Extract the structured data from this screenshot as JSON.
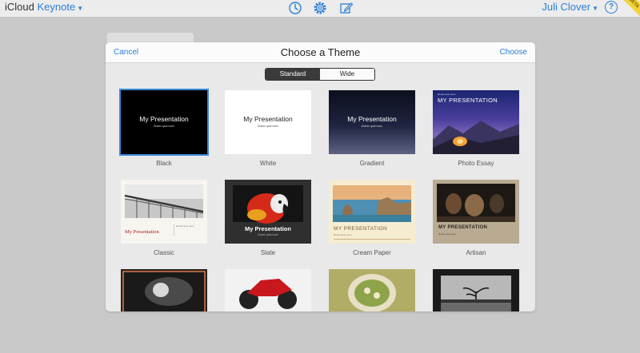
{
  "app": {
    "brand": "iCloud",
    "product": "Keynote",
    "user": "Juli Clover",
    "help": "?",
    "beta": "BETA"
  },
  "dialog": {
    "cancel": "Cancel",
    "title": "Choose a Theme",
    "choose": "Choose",
    "segments": [
      "Standard",
      "Wide"
    ],
    "placeholder_title": "My Presentation",
    "placeholder_title_caps": "MY PRESENTATION",
    "placeholder_sub": "Donec quis nunc",
    "themes": [
      "Black",
      "White",
      "Gradient",
      "Photo Essay",
      "Classic",
      "Slate",
      "Cream Paper",
      "Artisan"
    ]
  },
  "colors": {
    "accent": "#2c7fd6",
    "selected_outline": "#3d86d8"
  },
  "icons": [
    "history-icon",
    "settings-gear-icon",
    "compose-icon",
    "help-icon"
  ]
}
